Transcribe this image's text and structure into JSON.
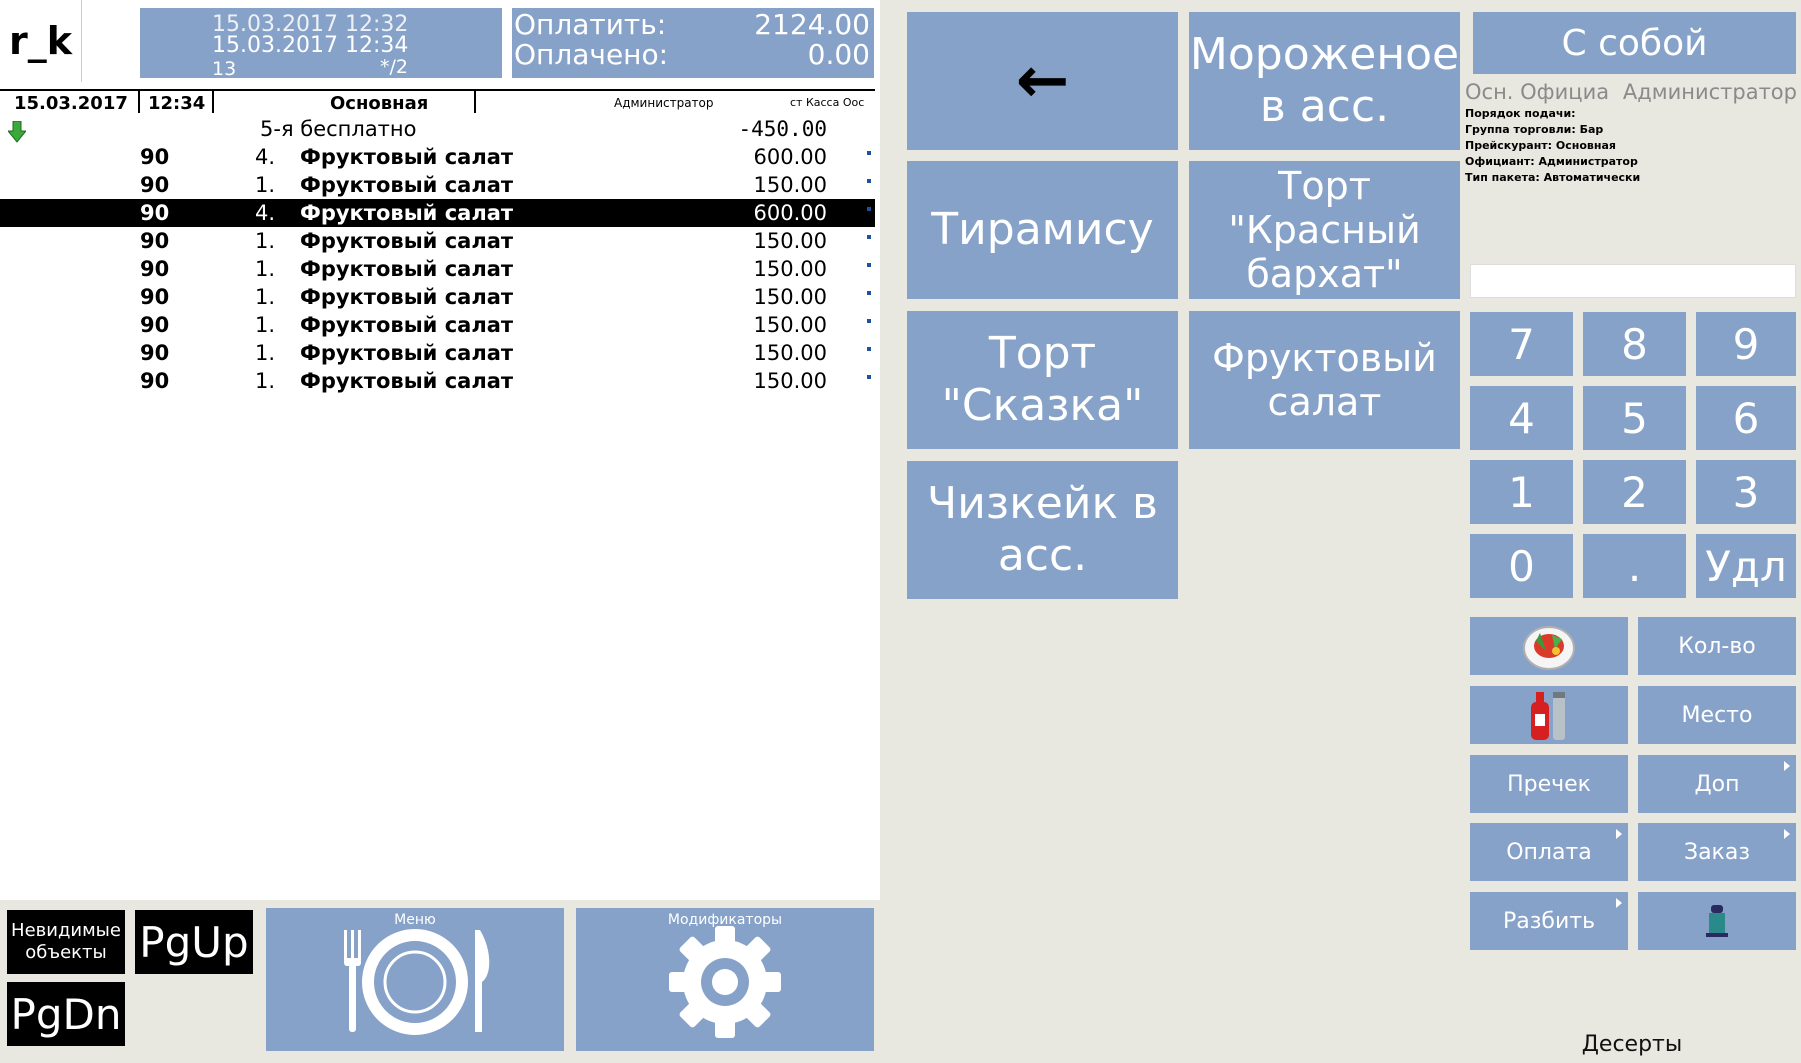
{
  "header": {
    "logo": "r_k",
    "datetime_prev": "15.03.2017 12:32",
    "datetime_current": "15.03.2017 12:34",
    "table_number": "13",
    "guests": "*/2",
    "pay_label": "Оплатить:",
    "pay_value": "2124.00",
    "paid_label": "Оплачено:",
    "paid_value": "0.00"
  },
  "order_header": {
    "date": "15.03.2017",
    "time": "12:34",
    "price_list": "Основная",
    "waiter": "Администратор",
    "station": "ст Касса Оос"
  },
  "order": {
    "discount": {
      "name": "5-я бесплатно",
      "price": "-450.00"
    },
    "items": [
      {
        "code": "90",
        "qty": "4.",
        "name": "Фруктовый салат",
        "price": "600.00",
        "selected": false
      },
      {
        "code": "90",
        "qty": "1.",
        "name": "Фруктовый салат",
        "price": "150.00",
        "selected": false
      },
      {
        "code": "90",
        "qty": "4.",
        "name": "Фруктовый салат",
        "price": "600.00",
        "selected": true
      },
      {
        "code": "90",
        "qty": "1.",
        "name": "Фруктовый салат",
        "price": "150.00",
        "selected": false
      },
      {
        "code": "90",
        "qty": "1.",
        "name": "Фруктовый салат",
        "price": "150.00",
        "selected": false
      },
      {
        "code": "90",
        "qty": "1.",
        "name": "Фруктовый салат",
        "price": "150.00",
        "selected": false
      },
      {
        "code": "90",
        "qty": "1.",
        "name": "Фруктовый салат",
        "price": "150.00",
        "selected": false
      },
      {
        "code": "90",
        "qty": "1.",
        "name": "Фруктовый салат",
        "price": "150.00",
        "selected": false
      },
      {
        "code": "90",
        "qty": "1.",
        "name": "Фруктовый салат",
        "price": "150.00",
        "selected": false
      }
    ]
  },
  "bottom_left": {
    "invisible_objects": "Невидимые объекты",
    "pgup": "PgUp",
    "pgdn": "PgDn",
    "menu_label": "Меню",
    "modifiers_label": "Модификаторы"
  },
  "dishes": {
    "back": "←",
    "icecream": "Мороженое в асс.",
    "tiramisu": "Тирамису",
    "red_velvet": "Торт \"Красный бархат\"",
    "skazka": "Торт \"Сказка\"",
    "fruit_salad": "Фруктовый салат",
    "cheesecake": "Чизкейк в асс."
  },
  "right": {
    "togo": "С собой",
    "info_left": "Осн. Официа",
    "info_right": "Администратор",
    "info_lines": [
      "Порядок подачи:",
      "Группа торговли: Бар",
      "Прейскурант: Основная",
      "Официант: Администратор",
      "Тип пакета: Автоматически"
    ],
    "keypad": [
      "7",
      "8",
      "9",
      "4",
      "5",
      "6",
      "1",
      "2",
      "3",
      "0",
      ".",
      "Удл"
    ],
    "qty": "Кол-во",
    "place": "Место",
    "precheck": "Пречек",
    "dop": "Доп",
    "payment": "Оплата",
    "order": "Заказ",
    "split": "Разбить",
    "category": "Десерты"
  },
  "colors": {
    "tile_blue": "#86a2c9",
    "background": "#e9e8e0",
    "selected_row": "#000000"
  }
}
